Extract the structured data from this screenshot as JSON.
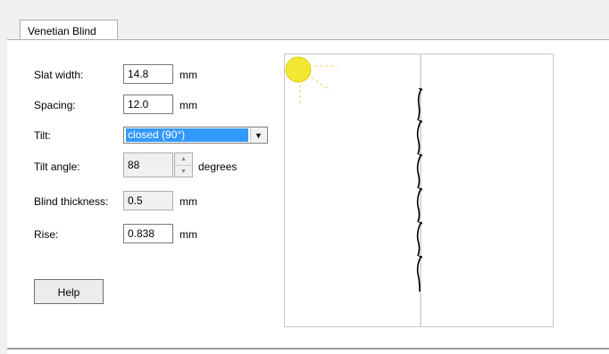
{
  "tab": {
    "label": "Venetian Blind"
  },
  "fields": {
    "slat_width": {
      "label": "Slat width:",
      "value": "14.8",
      "unit": "mm"
    },
    "spacing": {
      "label": "Spacing:",
      "value": "12.0",
      "unit": "mm"
    },
    "tilt": {
      "label": "Tilt:",
      "selected": "closed (90°)"
    },
    "tilt_angle": {
      "label": "Tilt angle:",
      "value": "88",
      "unit": "degrees"
    },
    "blind_thickness": {
      "label": "Blind thickness:",
      "value": "0.5",
      "unit": "mm"
    },
    "rise": {
      "label": "Rise:",
      "value": "0.838",
      "unit": "mm"
    }
  },
  "buttons": {
    "help": "Help"
  },
  "colors": {
    "sun": "#f2e832",
    "selection": "#3399ff"
  },
  "icons": {
    "sun": "sun-icon",
    "dropdown": "chevron-down-icon",
    "spin_up": "spin-up-icon",
    "spin_down": "spin-down-icon"
  }
}
